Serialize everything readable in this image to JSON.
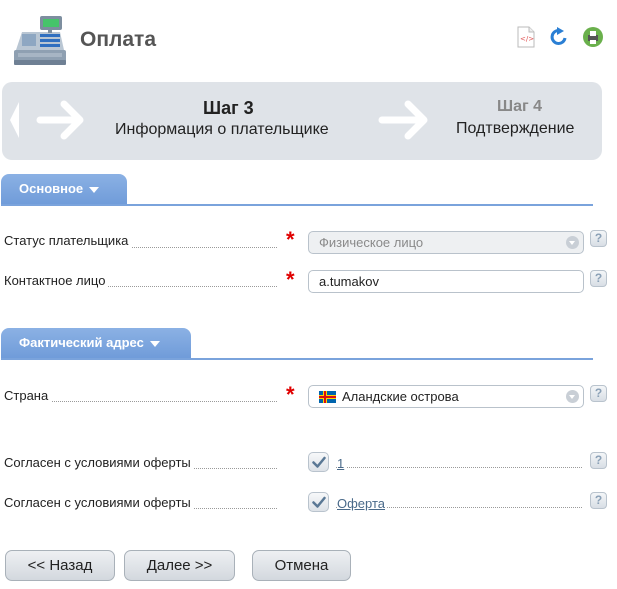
{
  "header": {
    "title": "Оплата",
    "icons": [
      "cash-register-icon",
      "code-file-icon",
      "refresh-icon",
      "print-icon"
    ]
  },
  "steps": {
    "current": {
      "title": "Шаг 3",
      "subtitle": "Информация о плательщике"
    },
    "next": {
      "title": "Шаг 4",
      "subtitle": "Подтверждение"
    }
  },
  "sections": {
    "main": {
      "label": "Основное"
    },
    "address": {
      "label": "Фактический адрес"
    }
  },
  "form": {
    "payer_status": {
      "label": "Статус плательщика",
      "value": "Физическое лицо",
      "required": "*"
    },
    "contact": {
      "label": "Контактное лицо",
      "value": "a.tumakov",
      "required": "*"
    },
    "country": {
      "label": "Страна",
      "value": "Аландские острова",
      "required": "*"
    },
    "agree1": {
      "label": "Согласен с условиями оферты",
      "link": "1",
      "checked": true
    },
    "agree2": {
      "label": "Согласен с условиями оферты",
      "link": "Оферта",
      "checked": true
    },
    "help_glyph": "?"
  },
  "buttons": {
    "back": "<< Назад",
    "next": "Далее >>",
    "cancel": "Отмена"
  },
  "colors": {
    "tab": "#6f9bd9",
    "required": "#e00000",
    "steps_bg": "#dfe3e8"
  }
}
